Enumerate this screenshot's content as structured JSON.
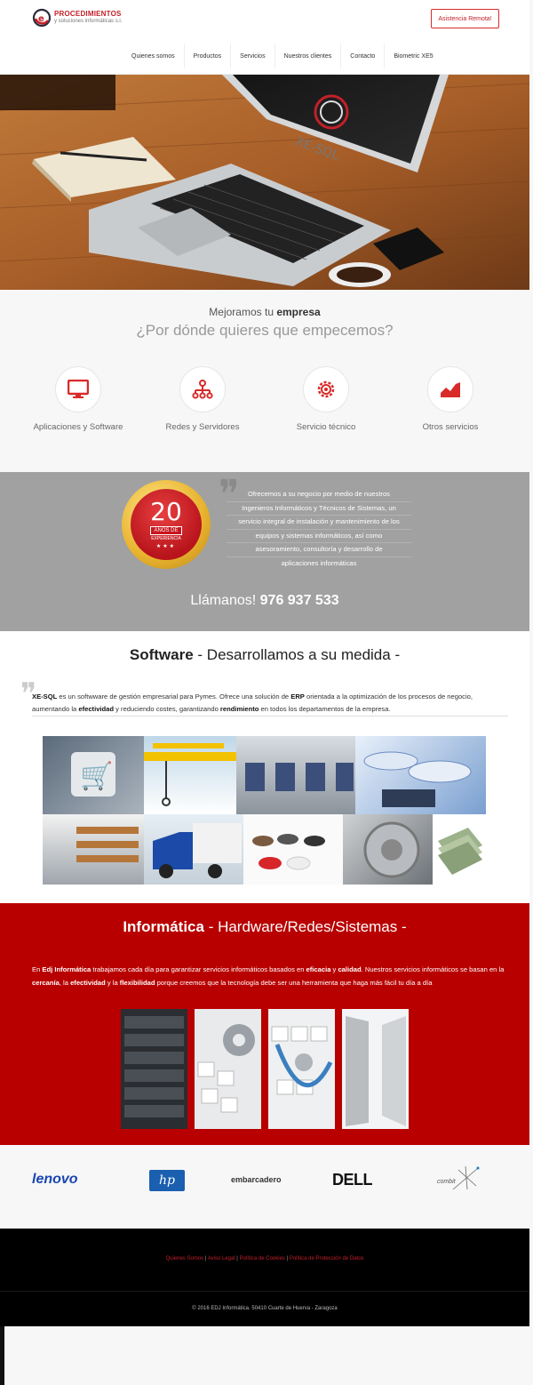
{
  "header": {
    "logo_line1": "PROCEDIMIENTOS",
    "logo_line2": "y soluciones informáticas s.l.",
    "cta_label": "Asistencia Remota!"
  },
  "nav": [
    "Quienes somos",
    "Productos",
    "Servicios",
    "Nuestros clientes",
    "Contacto",
    "Biometric XE5"
  ],
  "hero": {
    "screen_text": "XE-SQL"
  },
  "services": {
    "heading_pre": "Mejoramos tu ",
    "heading_bold": "empresa",
    "subheading": "¿Por dónde quieres que empecemos?",
    "items": [
      {
        "label": "Aplicaciones y Software",
        "icon": "monitor-icon"
      },
      {
        "label": "Redes y Servidores",
        "icon": "network-icon"
      },
      {
        "label": "Servicio técnico",
        "icon": "gear-icon"
      },
      {
        "label": "Otros servicios",
        "icon": "chart-icon"
      }
    ],
    "accent": "#d92a2a"
  },
  "band": {
    "badge_number": "20",
    "badge_ribbon": "AÑOS DE",
    "badge_sub": "EXPERIENCIA",
    "lines": [
      "Ofrecemos a su negocio por medio de nuestros",
      "Ingenieros Informáticos y Técnicos de Sistemas, un",
      "servicio integral de instalación y mantenimiento de los",
      "equipos y sistemas informáticos, así como",
      "asesoramiento, consultoría y desarrollo de",
      "aplicaciones informáticas"
    ],
    "call_pre": "Llámanos! ",
    "call_number": "976 937 533"
  },
  "software": {
    "title_bold": "Software",
    "title_rest": " - Desarrollamos a su medida -",
    "text": {
      "t1": "XE-SQL",
      "t2": " es un softwware de gestión empresarial para Pymes. Ofrece una solución de ",
      "t3": "ERP",
      "t4": " orientada a la optimización de los procesos de negocio, aumentando la ",
      "t5": "efectividad",
      "t6": " y reduciendo costes, garantizando ",
      "t7": "rendimiento",
      "t8": " en todos los departamentos de la empresa."
    }
  },
  "info": {
    "title_bold": "Informática",
    "title_rest": " - Hardware/Redes/Sistemas -",
    "text": {
      "t1": "En ",
      "t2": "Edj Informática",
      "t3": " trabajamos cada día para garantizar servicios informáticos basados en ",
      "t4": "eficacia",
      "t5": " y ",
      "t6": "calidad",
      "t7": ". Nuestros servicios informáticos se basan en la ",
      "t8": "cercanía",
      "t9": ", la ",
      "t10": "efectividad",
      "t11": " y la ",
      "t12": "flexibilidad",
      "t13": " porque creemos que la tecnología debe ser una herramienta que haga más fácil tu día a día"
    }
  },
  "brands": [
    "lenovo",
    "hp",
    "embarcadero",
    "DELL",
    "combit"
  ],
  "footer": {
    "links": [
      "Quienes Somos",
      "Aviso Legal",
      "Política de Cookies",
      "Política de Protección de Datos"
    ],
    "separator": " | ",
    "copyright": "© 2016 EDJ Informática. 50410 Cuarte de Huerva - Zaragoza"
  }
}
